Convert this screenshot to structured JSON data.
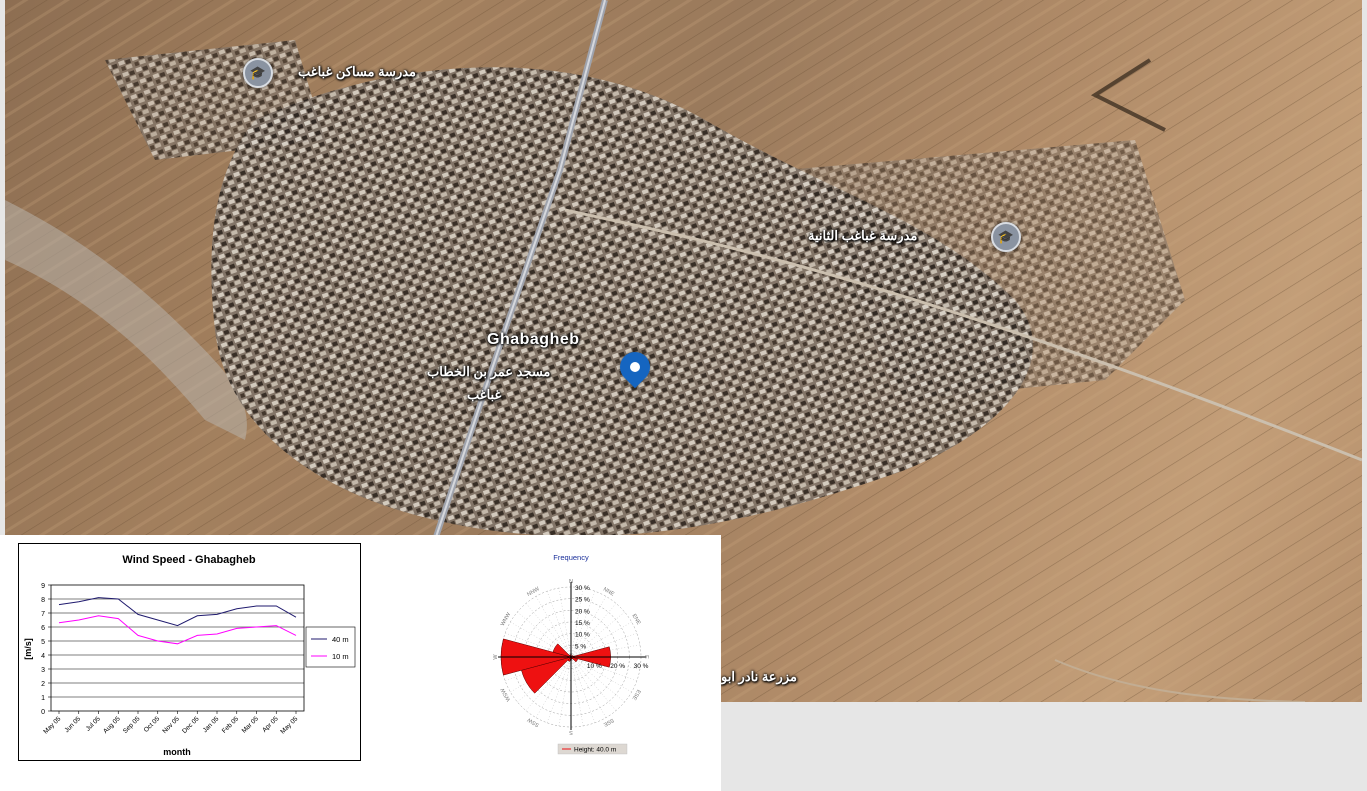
{
  "map": {
    "labels": {
      "school_1": "مدرسة مساكن غباغب",
      "school_2": "مدرسة غباغب الثانية",
      "town": "Ghabagheb",
      "mosque_line1": "مسجد عمر بن الخطاب",
      "mosque_line2": "غباغب",
      "farm": "مزرعة نادر ابو"
    },
    "icons": {
      "school": "school-cap-icon",
      "pin": "location-pin-icon"
    }
  },
  "chart_data": [
    {
      "type": "line",
      "title": "Wind Speed - Ghabagheb",
      "xlabel": "month",
      "ylabel": "[m/s]",
      "ylim": [
        0,
        9
      ],
      "yticks": [
        "0",
        "1",
        "2",
        "3",
        "4",
        "5",
        "6",
        "7",
        "8",
        "9"
      ],
      "categories": [
        "May 05",
        "Jun 05",
        "Jul 05",
        "Aug 05",
        "Sep 05",
        "Oct 05",
        "Nov 05",
        "Dec 05",
        "Jan 05",
        "Feb 05",
        "Mar 05",
        "Apr 05",
        "May 05"
      ],
      "series": [
        {
          "name": "40 m",
          "color": "#1f1a6e",
          "values": [
            7.6,
            7.8,
            8.1,
            8.0,
            6.9,
            6.5,
            6.1,
            6.8,
            6.9,
            7.3,
            7.5,
            7.5,
            6.7
          ]
        },
        {
          "name": "10 m",
          "color": "#ff00ff",
          "values": [
            6.3,
            6.5,
            6.8,
            6.6,
            5.4,
            5.0,
            4.8,
            5.4,
            5.5,
            5.9,
            6.0,
            6.1,
            5.4
          ]
        }
      ],
      "legend": "right",
      "grid": true
    },
    {
      "type": "wind-rose",
      "title": "Frequency",
      "directions": [
        "N",
        "NNE",
        "ENE",
        "E",
        "ESE",
        "SSE",
        "S",
        "SSW",
        "WSW",
        "W",
        "WNW",
        "NNW"
      ],
      "radial_ticks": [
        "5 %",
        "10 %",
        "15 %",
        "20 %",
        "25 %",
        "30 %"
      ],
      "rmax": 30,
      "values": [
        1,
        0.5,
        1,
        17,
        3,
        1,
        1,
        2,
        22,
        30,
        8,
        1
      ],
      "legend": "Height: 40.0 m",
      "color": "#ee1111"
    }
  ]
}
